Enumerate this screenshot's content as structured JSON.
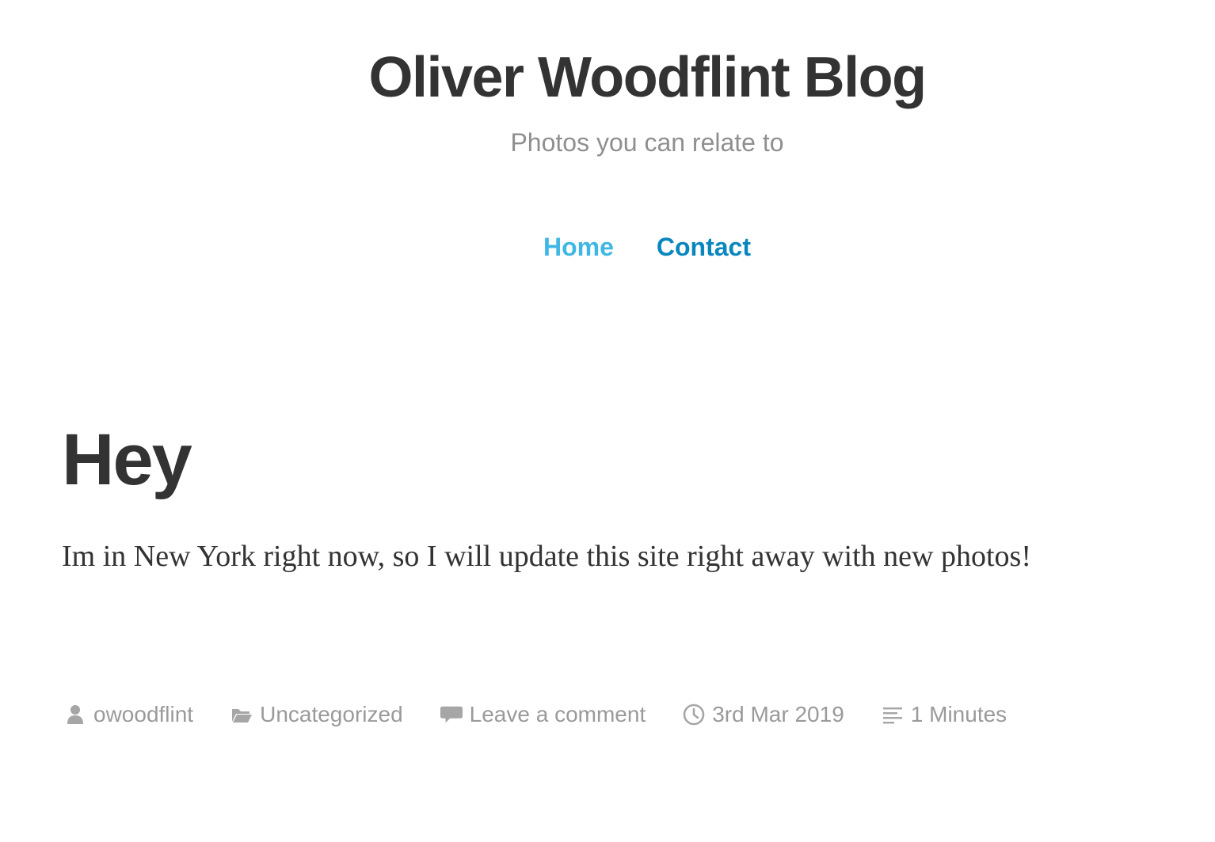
{
  "site": {
    "title": "Oliver Woodflint Blog",
    "description": "Photos you can relate to"
  },
  "nav": {
    "items": [
      {
        "label": "Home",
        "color": "#3fb7e4"
      },
      {
        "label": "Contact",
        "color": "#0a86bf"
      }
    ]
  },
  "post": {
    "title": "Hey",
    "content": "Im in New York right now, so I will update this site right away with new photos!",
    "meta": {
      "author": {
        "icon": "person-icon",
        "text": "owoodflint"
      },
      "category": {
        "icon": "folder-icon",
        "text": "Uncategorized"
      },
      "comments": {
        "icon": "comment-icon",
        "text": "Leave a comment"
      },
      "date": {
        "icon": "clock-icon",
        "text": "3rd Mar 2019"
      },
      "reading_time": {
        "icon": "text-lines-icon",
        "text": "1 Minutes"
      }
    }
  },
  "colors": {
    "text": "#333333",
    "muted": "#9a9a9a",
    "description": "#8f8f8f",
    "background": "#ffffff"
  }
}
